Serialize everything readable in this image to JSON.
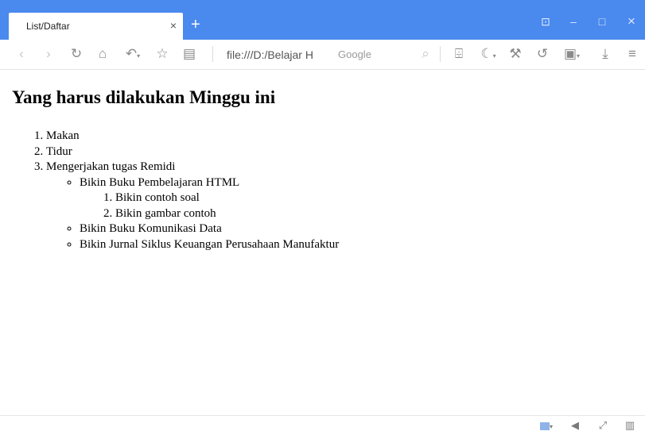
{
  "browser": {
    "tab_title": "List/Daftar",
    "tab_close": "×",
    "new_tab": "+",
    "window_controls": {
      "restore": "⊡",
      "minimize": "–",
      "maximize": "□",
      "close": "×"
    },
    "address": "file:///D:/Belajar H",
    "search_placeholder": "Google",
    "nav_icons": [
      "back-icon",
      "forward-icon",
      "reload-icon",
      "home-icon",
      "undo-icon",
      "favorite-star-icon",
      "reader-icon"
    ],
    "tool_icons": [
      "search-icon",
      "screenshot-icon",
      "night-mode-icon",
      "tools-icon",
      "history-icon",
      "capture-icon",
      "download-icon",
      "menu-icon"
    ]
  },
  "page": {
    "heading": "Yang harus dilakukan Minggu ini",
    "items": [
      {
        "label": "Makan"
      },
      {
        "label": "Tidur"
      },
      {
        "label": "Mengerjakan tugas Remidi",
        "sub": [
          {
            "label": "Bikin Buku Pembelajaran HTML",
            "sub": [
              "Bikin contoh soal",
              "Bikin gambar contoh"
            ]
          },
          {
            "label": "Bikin Buku Komunikasi Data"
          },
          {
            "label": "Bikin Jurnal Siklus Keuangan Perusahaan Manufaktur"
          }
        ]
      }
    ]
  },
  "statusbar": {
    "icons": [
      "performance-icon",
      "volume-icon",
      "expand-icon",
      "layout-icon"
    ]
  },
  "colors": {
    "titlebar": "#4a89ee",
    "icon": "#8a8a8a"
  }
}
